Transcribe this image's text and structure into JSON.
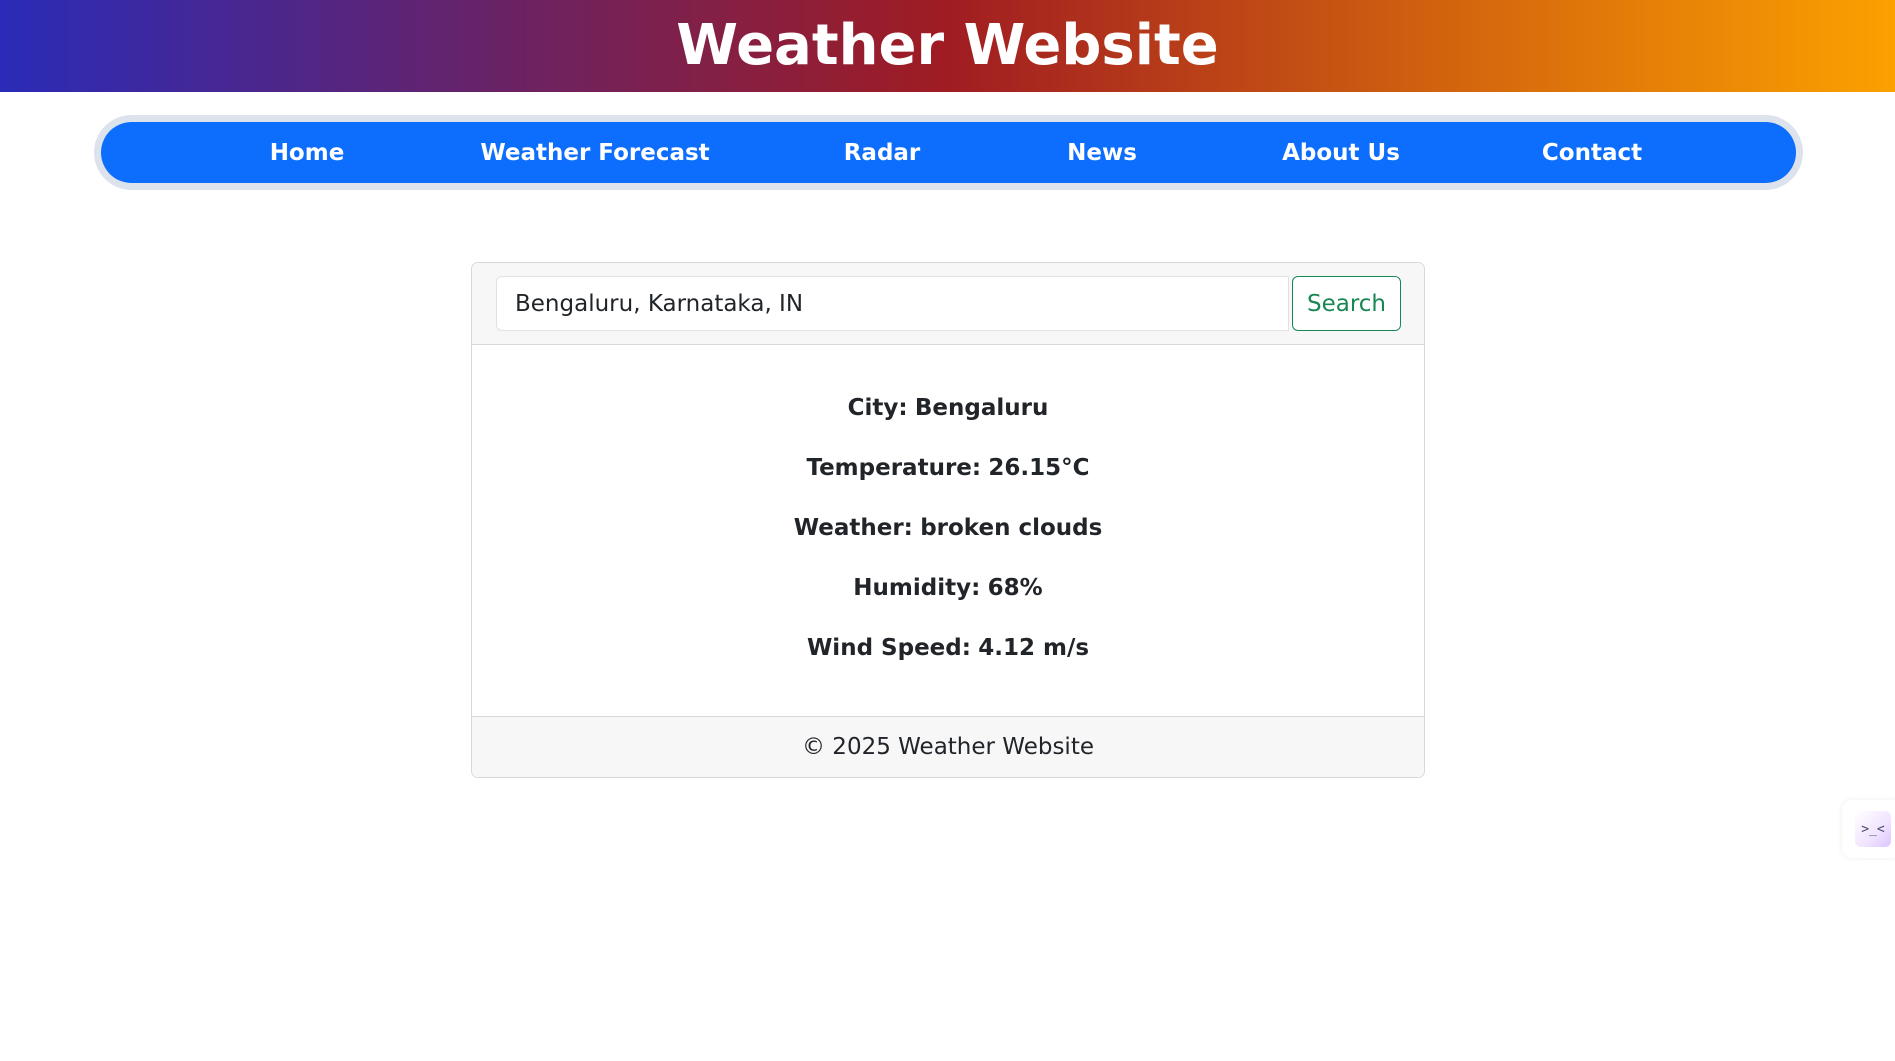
{
  "header": {
    "title": "Weather Website"
  },
  "nav": {
    "items": [
      {
        "label": "Home"
      },
      {
        "label": "Weather Forecast"
      },
      {
        "label": "Radar"
      },
      {
        "label": "News"
      },
      {
        "label": "About Us"
      },
      {
        "label": "Contact"
      }
    ]
  },
  "search": {
    "value": "Bengaluru, Karnataka, IN",
    "button_label": "Search"
  },
  "weather": {
    "city_label": "City:",
    "city_value": "Bengaluru",
    "temperature_label": "Temperature:",
    "temperature_value": "26.15°C",
    "condition_label": "Weather:",
    "condition_value": "broken clouds",
    "humidity_label": "Humidity:",
    "humidity_value": "68%",
    "wind_label": "Wind Speed:",
    "wind_value": "4.12 m/s"
  },
  "footer": {
    "text": "© 2025 Weather Website"
  },
  "side_widget": {
    "icon": "terminal-icon",
    "glyph": ">_<"
  },
  "colors": {
    "nav_blue": "#0d6efd",
    "search_green": "#198754",
    "header_gradient": [
      "#2a2bb8",
      "#a01c22",
      "#fba100"
    ]
  }
}
